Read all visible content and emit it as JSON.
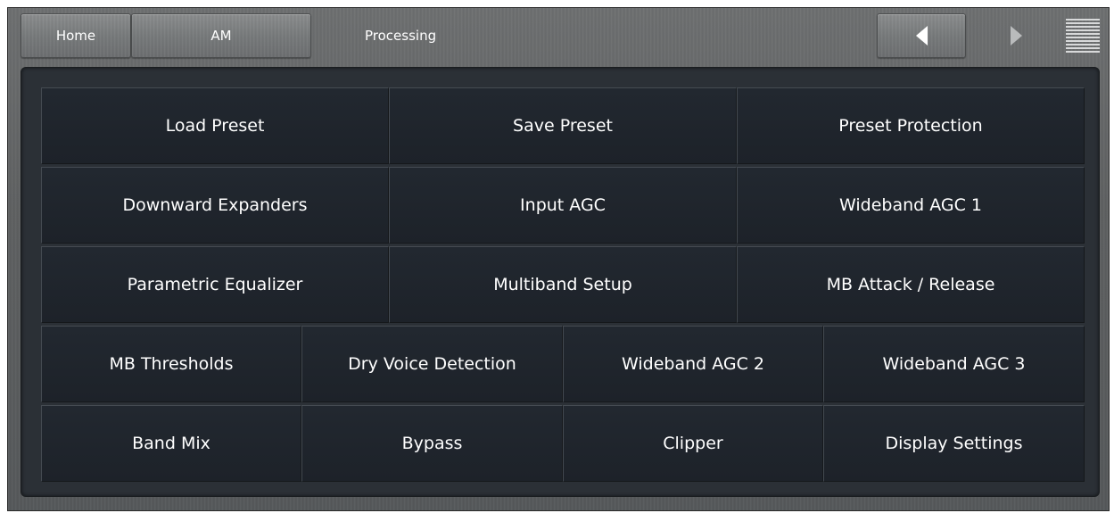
{
  "header": {
    "home_label": "Home",
    "am_label": "AM",
    "title": "Processing"
  },
  "icons": {
    "prev": "arrow-left-icon",
    "next": "arrow-right-icon",
    "menu": "hamburger-menu-icon"
  },
  "grid": {
    "row1": [
      "Load Preset",
      "Save Preset",
      "Preset Protection"
    ],
    "row2": [
      "Downward Expanders",
      "Input AGC",
      "Wideband AGC 1"
    ],
    "row3": [
      "Parametric Equalizer",
      "Multiband Setup",
      "MB Attack / Release"
    ],
    "row4": [
      "MB Thresholds",
      "Dry Voice Detection",
      "Wideband AGC 2",
      "Wideband AGC 3"
    ],
    "row5": [
      "Band Mix",
      "Bypass",
      "Clipper",
      "Display Settings"
    ]
  },
  "colors": {
    "panel_bg": "#2b3036",
    "button_bg": "#1f242b",
    "bezel": "#5e6061",
    "text": "#ffffff"
  }
}
